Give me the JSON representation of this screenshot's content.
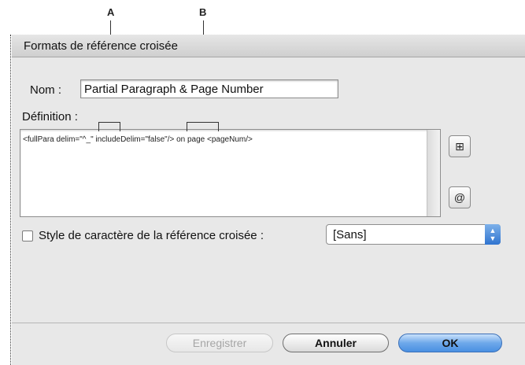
{
  "callouts": {
    "a": "A",
    "b": "B"
  },
  "dialog": {
    "title": "Formats de référence croisée",
    "nom_label": "Nom :",
    "nom_value": "Partial Paragraph & Page Number",
    "definition_label": "Définition :",
    "definition_text": "<fullPara delim=\"^_\" includeDelim=\"false\"/> on page <pageNum/>",
    "insert_tag_icon": "insert-tag-icon",
    "special_char_icon": "special-character-icon",
    "char_style_label": "Style de caractère de la référence croisée :",
    "char_style_checked": false,
    "char_style_value": "[Sans]",
    "buttons": {
      "save": "Enregistrer",
      "cancel": "Annuler",
      "ok": "OK"
    }
  }
}
